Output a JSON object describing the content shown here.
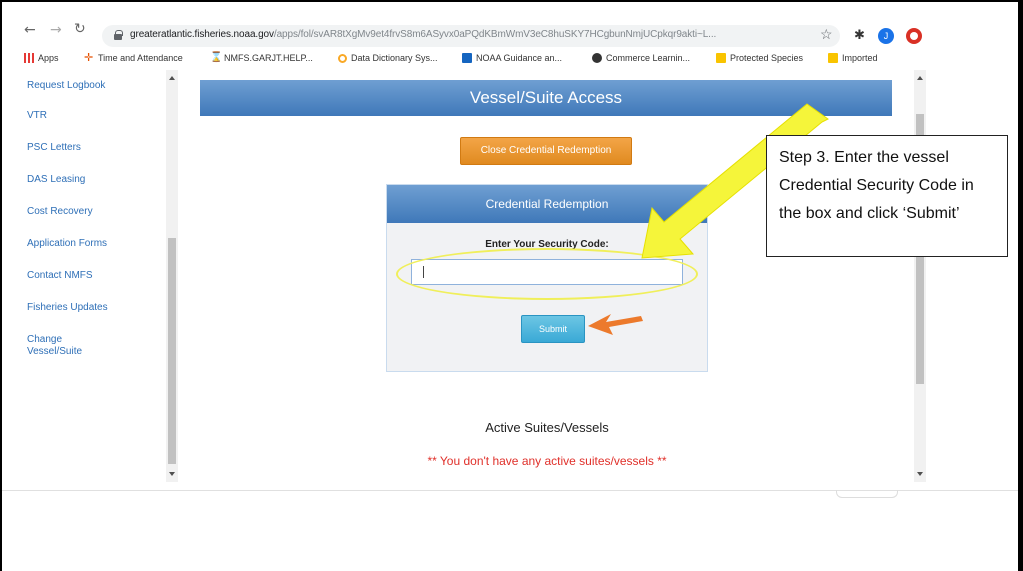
{
  "browser": {
    "url_host": "greateratlantic.fisheries.noaa.gov",
    "url_path": "/apps/fol/svAR8tXgMv9et4frvS8m6ASyvx0aPQdKBmWmV3eC8huSKY7HCgbunNmjUCpkqr9akti~L..."
  },
  "bookmarks": [
    {
      "label": "Apps"
    },
    {
      "label": "Time and Attendance"
    },
    {
      "label": "NMFS.GARJT.HELP..."
    },
    {
      "label": "Data Dictionary Sys..."
    },
    {
      "label": "NOAA Guidance an..."
    },
    {
      "label": "Commerce Learnin..."
    },
    {
      "label": "Protected Species"
    },
    {
      "label": "Imported"
    }
  ],
  "sidebar": {
    "items": [
      {
        "label": "Request Logbook"
      },
      {
        "label": "VTR"
      },
      {
        "label": "PSC Letters"
      },
      {
        "label": "DAS Leasing"
      },
      {
        "label": "Cost Recovery"
      },
      {
        "label": "Application Forms"
      },
      {
        "label": "Contact NMFS"
      },
      {
        "label": "Fisheries Updates"
      },
      {
        "label": "Change Vessel/Suite"
      }
    ]
  },
  "main": {
    "banner_title": "Vessel/Suite Access",
    "close_button": "Close Credential Redemption",
    "credential_header": "Credential Redemption",
    "security_label": "Enter Your Security Code:",
    "security_value": "",
    "submit_label": "Submit",
    "active_title": "Active Suites/Vessels",
    "active_message": "** You don't have any active suites/vessels **"
  },
  "annotation": {
    "text": "Step 3. Enter the vessel Credential Security Code in the box and click ‘Submit’",
    "arrow_color": "#f5f53a",
    "small_arrow_color": "#ec7a2c",
    "highlight_color": "#f0ef5a"
  },
  "icons": [
    "back-icon",
    "forward-icon",
    "reload-icon",
    "lock-icon",
    "star-icon",
    "puzzle-icon",
    "profile-icon",
    "extension-icon"
  ]
}
